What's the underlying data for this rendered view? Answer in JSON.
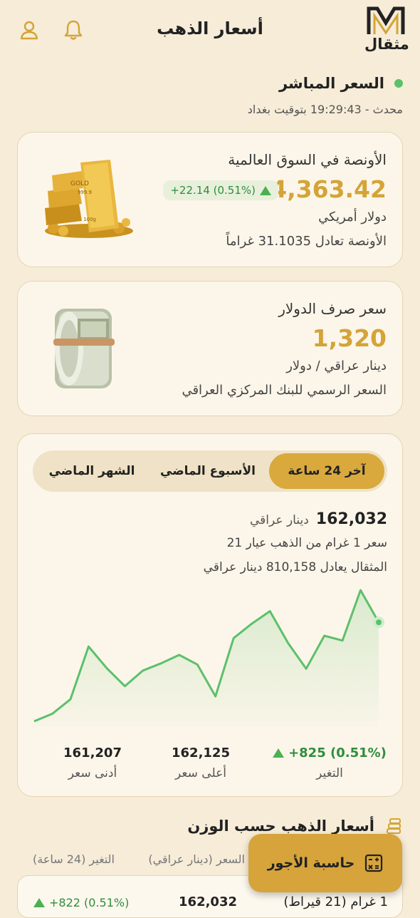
{
  "header": {
    "title": "أسعار الذهب",
    "logo_text": "مثقال",
    "logo_letter": "M"
  },
  "live": {
    "title": "السعر المباشر",
    "updated": "محدث - 19:29:43 بتوقيت بغداد"
  },
  "ounce_card": {
    "title": "الأونصة في السوق العالمية",
    "price": "4,363.42",
    "change": "+22.14 (0.51%)",
    "currency": "دولار أمريكي",
    "note": "الأونصة تعادل 31.1035 غراماً",
    "bar_stamp": "GOLD",
    "bar_purity": "999.9",
    "bar_weight": "100g"
  },
  "dollar_card": {
    "title": "سعر صرف الدولار",
    "price": "1,320",
    "unit": "دينار عراقي / دولار",
    "note": "السعر الرسمي للبنك المركزي العراقي"
  },
  "chart_card": {
    "tabs": [
      "آخر 24 ساعة",
      "الأسبوع الماضي",
      "الشهر الماضي"
    ],
    "active_tab": 0,
    "price": "162,032",
    "price_unit": "دينار عراقي",
    "desc": "سعر 1 غرام من الذهب عيار 21",
    "mithqal": "المثقال يعادل 810,158 دينار عراقي",
    "stats": {
      "change_value": "+825 (0.51%)",
      "change_label": "التغير",
      "high_value": "162,125",
      "high_label": "أعلى سعر",
      "low_value": "161,207",
      "low_label": "أدنى سعر"
    }
  },
  "chart_data": {
    "type": "area",
    "x": [
      0,
      1,
      2,
      3,
      4,
      5,
      6,
      7,
      8,
      9,
      10,
      11,
      12,
      13,
      14,
      15,
      16,
      17,
      18,
      19
    ],
    "values": [
      161207,
      161270,
      161390,
      161830,
      161650,
      161500,
      161630,
      161690,
      161760,
      161680,
      161415,
      161900,
      162020,
      162125,
      161860,
      161645,
      161920,
      161880,
      162300,
      162032
    ],
    "color": "#5cc06b",
    "grid": false,
    "axes_visible": false
  },
  "weights": {
    "title": "أسعار الذهب حسب الوزن",
    "col_price": "السعر (دينار عراقي)",
    "col_change": "التغير (24 ساعة)",
    "rows": [
      {
        "label": "1 غرام (21 قيراط)",
        "price": "162,032",
        "change": "+822 (0.51%)"
      }
    ]
  },
  "fab": {
    "label": "حاسبة الأجور"
  },
  "colors": {
    "background": "#f6ecd8",
    "gold": "#d4a437",
    "green": "#5cc06b"
  }
}
